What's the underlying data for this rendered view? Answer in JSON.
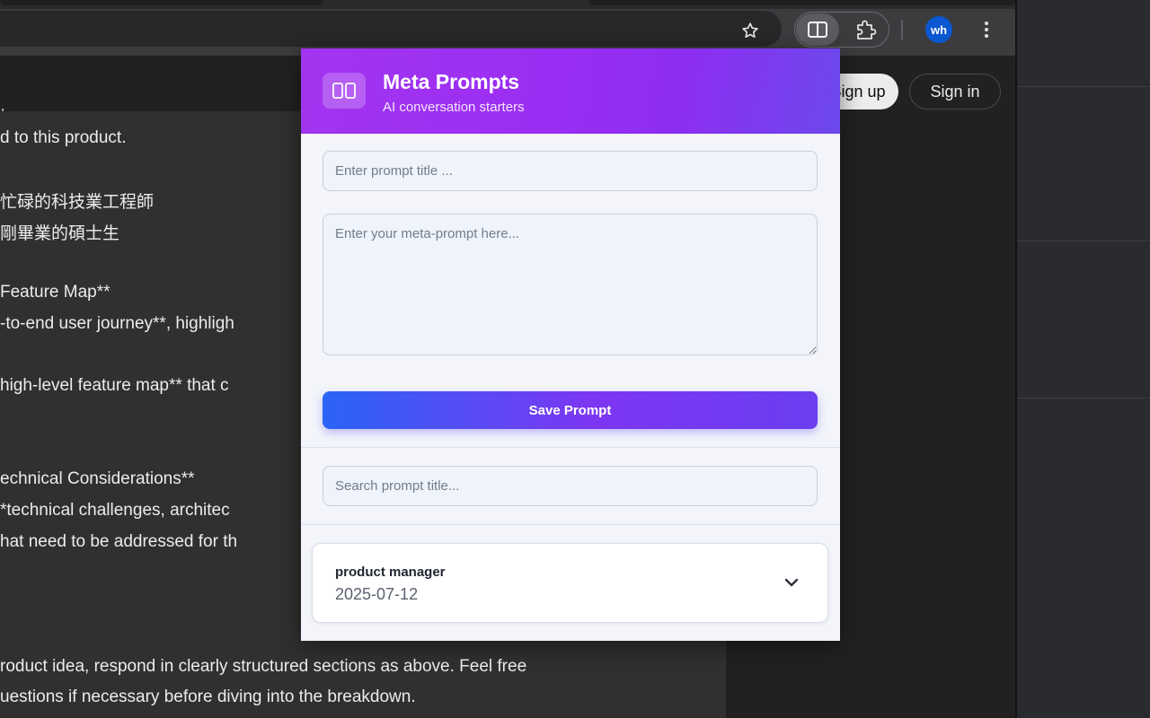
{
  "browser": {
    "profile_initials": "wh",
    "icons": [
      "star-icon",
      "side-panel-icon",
      "extensions-puzzle-icon",
      "more-menu-icon"
    ]
  },
  "site": {
    "signup_label": "Sign up",
    "signin_label": "Sign in",
    "doc_lines": [
      "d to this product.",
      "忙碌的科技業工程師",
      "剛畢業的碩士生",
      "Feature Map**",
      "-to-end user journey**, highligh",
      "high-level feature map** that c",
      "echnical Considerations**",
      "*technical challenges, architec",
      "hat need to be addressed for th",
      "roduct idea, respond in clearly structured sections as above. Feel free",
      "uestions if necessary before diving into the breakdown."
    ]
  },
  "popup": {
    "title": "Meta Prompts",
    "subtitle": "AI conversation starters",
    "title_placeholder": "Enter prompt title ...",
    "prompt_placeholder": "Enter your meta-prompt here...",
    "save_label": "Save Prompt",
    "search_placeholder": "Search prompt title...",
    "prompts": [
      {
        "title": "product manager",
        "date": "2025-07-12"
      }
    ],
    "colors": {
      "header_start": "#a334f0",
      "header_end": "#6c49ec",
      "button_start": "#2a64f6",
      "button_end": "#7d36f2"
    }
  }
}
